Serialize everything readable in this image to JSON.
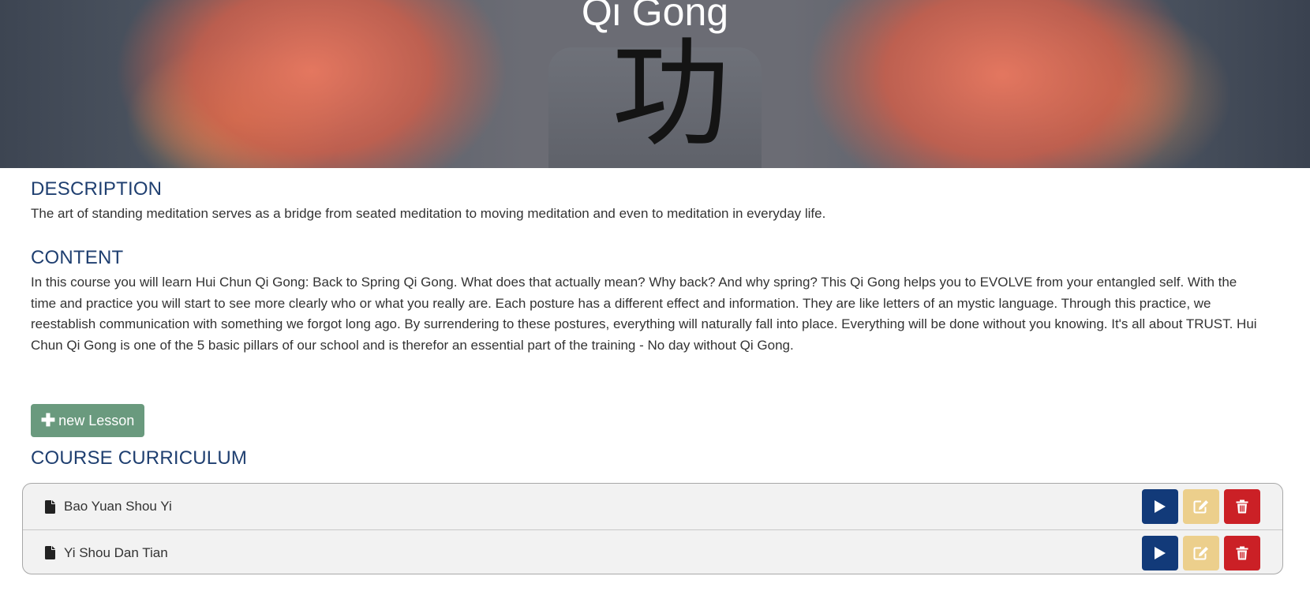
{
  "hero": {
    "title": "Qi Gong",
    "glyph": "功"
  },
  "description": {
    "heading": "DESCRIPTION",
    "text": "The art of standing meditation serves as a bridge from seated meditation to moving meditation and even to meditation in everyday life."
  },
  "content": {
    "heading": "CONTENT",
    "text": "In this course you will learn Hui Chun Qi Gong: Back to Spring Qi Gong. What does that actually mean? Why back? And why spring? This Qi Gong helps you to EVOLVE from your entangled self. With the time and practice you will start to see more clearly who or what you really are. Each posture has a different effect and information. They are like letters of an mystic language. Through this practice, we reestablish communication with something we forgot long ago. By surrendering to these postures, everything will naturally fall into place. Everything will be done without you knowing. It's all about TRUST. Hui Chun Qi Gong is one of the 5 basic pillars of our school and is therefor an essential part of the training - No day without Qi Gong."
  },
  "new_lesson": {
    "label": "new Lesson",
    "icon": "plus-icon"
  },
  "curriculum": {
    "heading": "COURSE CURRICULUM",
    "lessons": [
      {
        "title": "Bao Yuan Shou Yi",
        "icon": "file-icon"
      },
      {
        "title": "Yi Shou Dan Tian",
        "icon": "file-icon"
      }
    ],
    "actions": [
      "play-icon",
      "edit-icon",
      "trash-icon"
    ]
  },
  "colors": {
    "heading": "#1f3f70",
    "new_lesson": "#6a9a7e",
    "play": "#123a79",
    "edit": "#eccf8c",
    "delete": "#cb2026"
  }
}
